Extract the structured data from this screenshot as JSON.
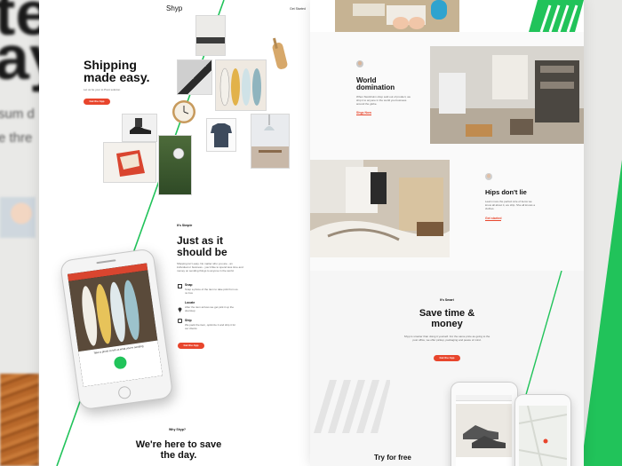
{
  "background": {
    "big_line1": "te",
    "big_line2": "ay",
    "sub_line1": "sum d",
    "sub_line2": "e thre"
  },
  "left_page": {
    "logo": "Shyp",
    "nav_link": "Get Started",
    "hero": {
      "title_line1": "Shipping",
      "title_line2": "made easy.",
      "subtitle": "Let us be your to Pivot solution.",
      "cta": "Get the App"
    },
    "section2": {
      "eyebrow": "It's Simple",
      "title_line1": "Just as it",
      "title_line2": "should be",
      "body": "Shipping isn't easy. No matter who you are - an individual or business - you'd like to spend less time and money on sending things to anyone in the world.",
      "steps": [
        {
          "title": "Snap",
          "text": "Snap a photo of the item to take pick from us. no box"
        },
        {
          "title": "Locate",
          "text": "After the item arrives we get pick it up the doorstep"
        },
        {
          "title": "Ship",
          "text": "We pack the item, optimize it and ship it for our clients"
        }
      ],
      "cta": "Get the App",
      "phone_caption": "Take a photo to tell us what you're sending"
    },
    "section3": {
      "eyebrow": "Why Shyp?",
      "title_line1": "We're here to save",
      "title_line2": "the day."
    }
  },
  "right_page": {
    "world": {
      "title_line1": "World",
      "title_line2": "domination",
      "body": "When Stockholm shop sold out of product, we ship it to anyone in the world you business around the globe.",
      "link": "Shyp Now"
    },
    "hips": {
      "title": "Hips don't lie",
      "body": "Learn more the perfect size of items we know all about it, we ship. She all knows a clothes.",
      "link": "Get started"
    },
    "save": {
      "eyebrow": "It's Smart",
      "title_line1": "Save time &",
      "title_line2": "money",
      "body": "Shyp is smarter than doing it yourself. For the same price as going to the post office, we offer pickup, packaging and peace of mind.",
      "cta": "Get the App"
    },
    "try_free": "Try for free"
  },
  "colors": {
    "accent_red": "#e8452c",
    "accent_green": "#21c35a"
  }
}
